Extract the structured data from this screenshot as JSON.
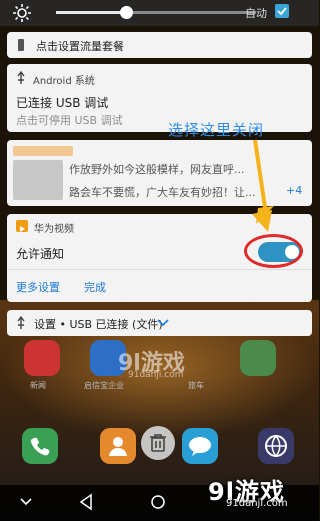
{
  "brightness": {
    "auto_label": "自动",
    "level": 0.35
  },
  "data_plan": {
    "label": "点击设置流量套餐"
  },
  "usb_debug": {
    "app_name": "Android 系统",
    "title": "已连接 USB 调试",
    "subtitle": "点击可停用 USB 调试"
  },
  "blurred_notification": {
    "line1": "作放野外如今这般模样，网友直呼...",
    "line2": "路会车不要慌，广大车友有妙招！让...",
    "count": "+4"
  },
  "huawei_video": {
    "app_name": "华为视频",
    "allow_label": "允许通知",
    "toggle_on": true,
    "more_settings": "更多设置",
    "done": "完成"
  },
  "settings_row": {
    "label": "设置 • USB 已连接 (文件)"
  },
  "annotation": {
    "text": "选择这里关闭"
  },
  "home": {
    "labels": [
      "新闻",
      "启信宝企业",
      "",
      "旅车"
    ]
  },
  "watermark": {
    "main": "9l游戏",
    "site": "91danji.com"
  },
  "colors": {
    "accent": "#2e93c4",
    "link": "#1d7ad6",
    "annotation_text": "#2f8fe8",
    "annotation_red": "#e02a2a",
    "arrow": "#f5b31b"
  }
}
